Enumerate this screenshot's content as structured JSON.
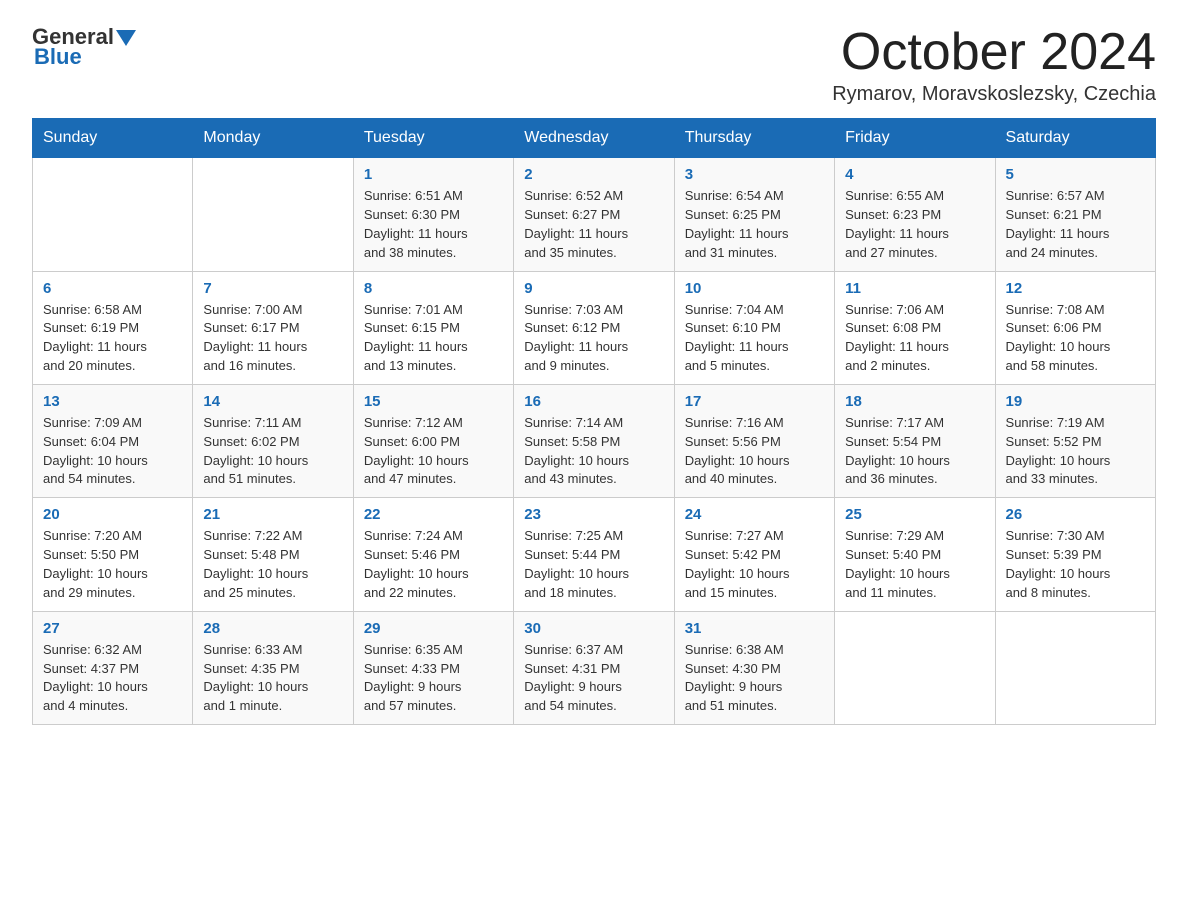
{
  "header": {
    "logo_general": "General",
    "logo_blue": "Blue",
    "month": "October 2024",
    "location": "Rymarov, Moravskoslezsky, Czechia"
  },
  "days_of_week": [
    "Sunday",
    "Monday",
    "Tuesday",
    "Wednesday",
    "Thursday",
    "Friday",
    "Saturday"
  ],
  "weeks": [
    [
      {
        "day": "",
        "info": ""
      },
      {
        "day": "",
        "info": ""
      },
      {
        "day": "1",
        "info": "Sunrise: 6:51 AM\nSunset: 6:30 PM\nDaylight: 11 hours\nand 38 minutes."
      },
      {
        "day": "2",
        "info": "Sunrise: 6:52 AM\nSunset: 6:27 PM\nDaylight: 11 hours\nand 35 minutes."
      },
      {
        "day": "3",
        "info": "Sunrise: 6:54 AM\nSunset: 6:25 PM\nDaylight: 11 hours\nand 31 minutes."
      },
      {
        "day": "4",
        "info": "Sunrise: 6:55 AM\nSunset: 6:23 PM\nDaylight: 11 hours\nand 27 minutes."
      },
      {
        "day": "5",
        "info": "Sunrise: 6:57 AM\nSunset: 6:21 PM\nDaylight: 11 hours\nand 24 minutes."
      }
    ],
    [
      {
        "day": "6",
        "info": "Sunrise: 6:58 AM\nSunset: 6:19 PM\nDaylight: 11 hours\nand 20 minutes."
      },
      {
        "day": "7",
        "info": "Sunrise: 7:00 AM\nSunset: 6:17 PM\nDaylight: 11 hours\nand 16 minutes."
      },
      {
        "day": "8",
        "info": "Sunrise: 7:01 AM\nSunset: 6:15 PM\nDaylight: 11 hours\nand 13 minutes."
      },
      {
        "day": "9",
        "info": "Sunrise: 7:03 AM\nSunset: 6:12 PM\nDaylight: 11 hours\nand 9 minutes."
      },
      {
        "day": "10",
        "info": "Sunrise: 7:04 AM\nSunset: 6:10 PM\nDaylight: 11 hours\nand 5 minutes."
      },
      {
        "day": "11",
        "info": "Sunrise: 7:06 AM\nSunset: 6:08 PM\nDaylight: 11 hours\nand 2 minutes."
      },
      {
        "day": "12",
        "info": "Sunrise: 7:08 AM\nSunset: 6:06 PM\nDaylight: 10 hours\nand 58 minutes."
      }
    ],
    [
      {
        "day": "13",
        "info": "Sunrise: 7:09 AM\nSunset: 6:04 PM\nDaylight: 10 hours\nand 54 minutes."
      },
      {
        "day": "14",
        "info": "Sunrise: 7:11 AM\nSunset: 6:02 PM\nDaylight: 10 hours\nand 51 minutes."
      },
      {
        "day": "15",
        "info": "Sunrise: 7:12 AM\nSunset: 6:00 PM\nDaylight: 10 hours\nand 47 minutes."
      },
      {
        "day": "16",
        "info": "Sunrise: 7:14 AM\nSunset: 5:58 PM\nDaylight: 10 hours\nand 43 minutes."
      },
      {
        "day": "17",
        "info": "Sunrise: 7:16 AM\nSunset: 5:56 PM\nDaylight: 10 hours\nand 40 minutes."
      },
      {
        "day": "18",
        "info": "Sunrise: 7:17 AM\nSunset: 5:54 PM\nDaylight: 10 hours\nand 36 minutes."
      },
      {
        "day": "19",
        "info": "Sunrise: 7:19 AM\nSunset: 5:52 PM\nDaylight: 10 hours\nand 33 minutes."
      }
    ],
    [
      {
        "day": "20",
        "info": "Sunrise: 7:20 AM\nSunset: 5:50 PM\nDaylight: 10 hours\nand 29 minutes."
      },
      {
        "day": "21",
        "info": "Sunrise: 7:22 AM\nSunset: 5:48 PM\nDaylight: 10 hours\nand 25 minutes."
      },
      {
        "day": "22",
        "info": "Sunrise: 7:24 AM\nSunset: 5:46 PM\nDaylight: 10 hours\nand 22 minutes."
      },
      {
        "day": "23",
        "info": "Sunrise: 7:25 AM\nSunset: 5:44 PM\nDaylight: 10 hours\nand 18 minutes."
      },
      {
        "day": "24",
        "info": "Sunrise: 7:27 AM\nSunset: 5:42 PM\nDaylight: 10 hours\nand 15 minutes."
      },
      {
        "day": "25",
        "info": "Sunrise: 7:29 AM\nSunset: 5:40 PM\nDaylight: 10 hours\nand 11 minutes."
      },
      {
        "day": "26",
        "info": "Sunrise: 7:30 AM\nSunset: 5:39 PM\nDaylight: 10 hours\nand 8 minutes."
      }
    ],
    [
      {
        "day": "27",
        "info": "Sunrise: 6:32 AM\nSunset: 4:37 PM\nDaylight: 10 hours\nand 4 minutes."
      },
      {
        "day": "28",
        "info": "Sunrise: 6:33 AM\nSunset: 4:35 PM\nDaylight: 10 hours\nand 1 minute."
      },
      {
        "day": "29",
        "info": "Sunrise: 6:35 AM\nSunset: 4:33 PM\nDaylight: 9 hours\nand 57 minutes."
      },
      {
        "day": "30",
        "info": "Sunrise: 6:37 AM\nSunset: 4:31 PM\nDaylight: 9 hours\nand 54 minutes."
      },
      {
        "day": "31",
        "info": "Sunrise: 6:38 AM\nSunset: 4:30 PM\nDaylight: 9 hours\nand 51 minutes."
      },
      {
        "day": "",
        "info": ""
      },
      {
        "day": "",
        "info": ""
      }
    ]
  ]
}
